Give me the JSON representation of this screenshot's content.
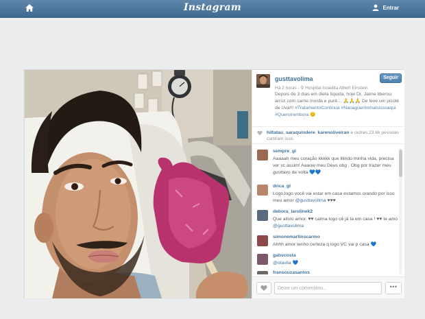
{
  "topbar": {
    "logo": "Instagram",
    "enter_label": "Entrar"
  },
  "post": {
    "username": "gusttavolima",
    "follow_label": "Seguir",
    "time": "Há 2 horas",
    "location": "Hospital Israelita Albert Einstein",
    "caption_text": "Depois de 3 dias em dieta líquida, hoje Dr. Jaime liberou arroz com carne moída e purê… 🙏🙏🙏 De leve um picolé de Uva!!!",
    "caption_tags": "#TratamentoContinua #Naoaguentomaisissoaqui #Queroirembora",
    "caption_tail": "😊",
    "likes": {
      "users": [
        "hiltatau",
        "saraquindere",
        "karenoliveiran"
      ],
      "suffix": "e outras 23,6k pessoas curtiram isso."
    }
  },
  "comments": [
    {
      "user": "sempre_gi",
      "text": "Aaaaah meu coração kkkkk que lliindo minha vida, precisa ver vc assim! Aaaow meu Deus obg , Obg por trazer meu gusttavo de volta 💙💙",
      "color": "#9b6a52"
    },
    {
      "user": "drica_gl",
      "text": "Logo,logo você vai estar em casa estamos orando por isso meu amor ",
      "mention": "@gusttavolima",
      "tail": " ♥♥♥",
      "color": "#b8876a"
    },
    {
      "user": "debora_larolinek2",
      "text": "Que alívio amor. ♥♥ calma logo cê já ta em casa ! ♥♥ te amo ",
      "mention": "@gusttavolima",
      "color": "#5a6b80"
    },
    {
      "user": "simonemartinscarmo",
      "text": "Ahhh amor tenho certeza q logo VC vai p casa 💙",
      "color": "#8a4a4a"
    },
    {
      "user": "gabvcosta",
      "text": "",
      "mention": "@otavila",
      "tail": " 💙",
      "color": "#7a5a6a"
    },
    {
      "user": "fransouzasantos",
      "text": "",
      "color": "#6a6a6a"
    }
  ],
  "footer": {
    "comment_placeholder": "Deixe um comentário...",
    "more_label": "•••"
  }
}
